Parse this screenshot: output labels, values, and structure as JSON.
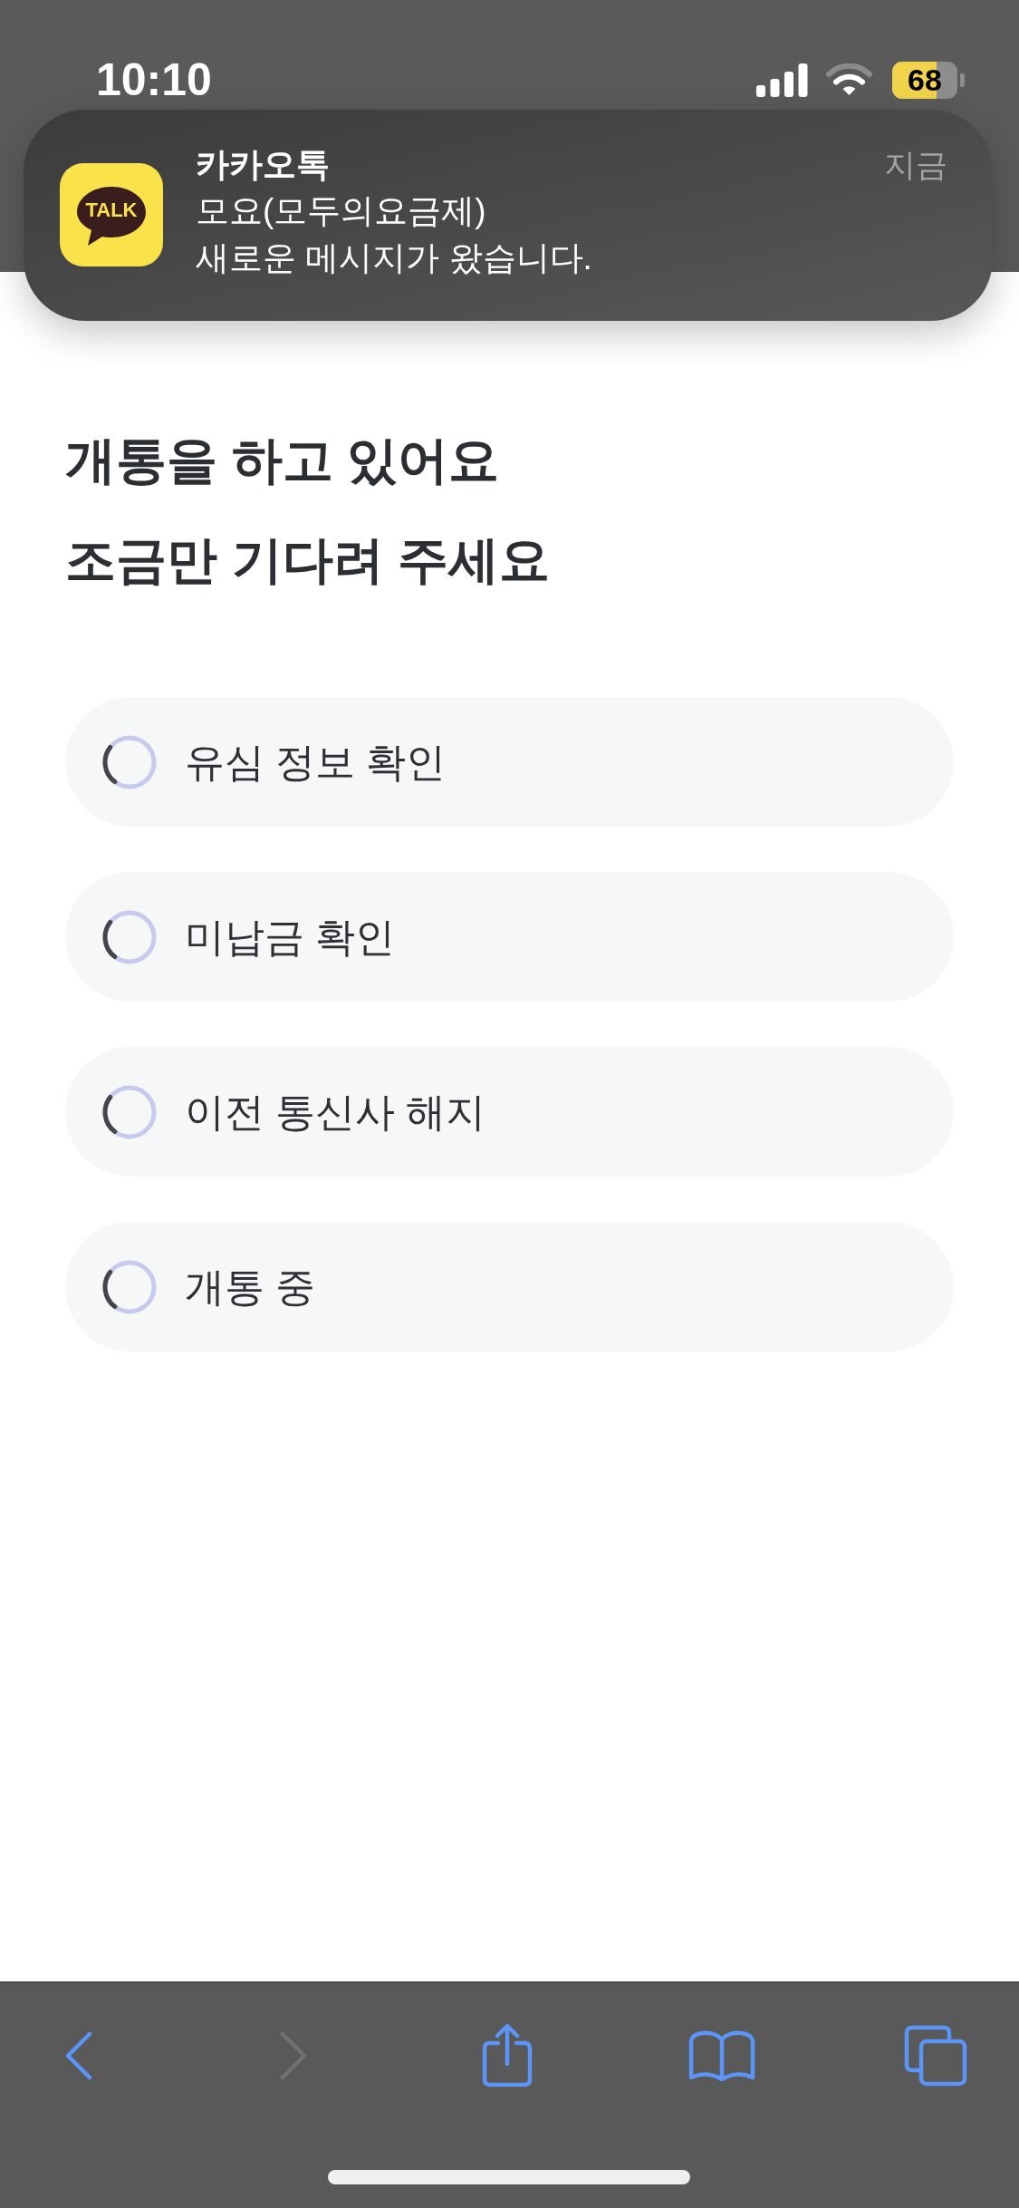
{
  "status_bar": {
    "time": "10:10",
    "battery": "68"
  },
  "notification": {
    "app_icon_text": "TALK",
    "app": "카카오톡",
    "time": "지금",
    "title": "모요(모두의요금제)",
    "message": "새로운 메시지가 왔습니다."
  },
  "heading": "개통을 하고 있어요\n조금만 기다려 주세요",
  "steps": [
    {
      "label": "유심 정보 확인"
    },
    {
      "label": "미납금 확인"
    },
    {
      "label": "이전 통신사 해지"
    },
    {
      "label": "개통 중"
    }
  ],
  "toolbar": {
    "buttons": [
      {
        "kind": "back",
        "disabled": false
      },
      {
        "kind": "forward",
        "disabled": true
      },
      {
        "kind": "share",
        "disabled": false
      },
      {
        "kind": "bookmarks",
        "disabled": false
      },
      {
        "kind": "tabs",
        "disabled": false
      }
    ]
  }
}
